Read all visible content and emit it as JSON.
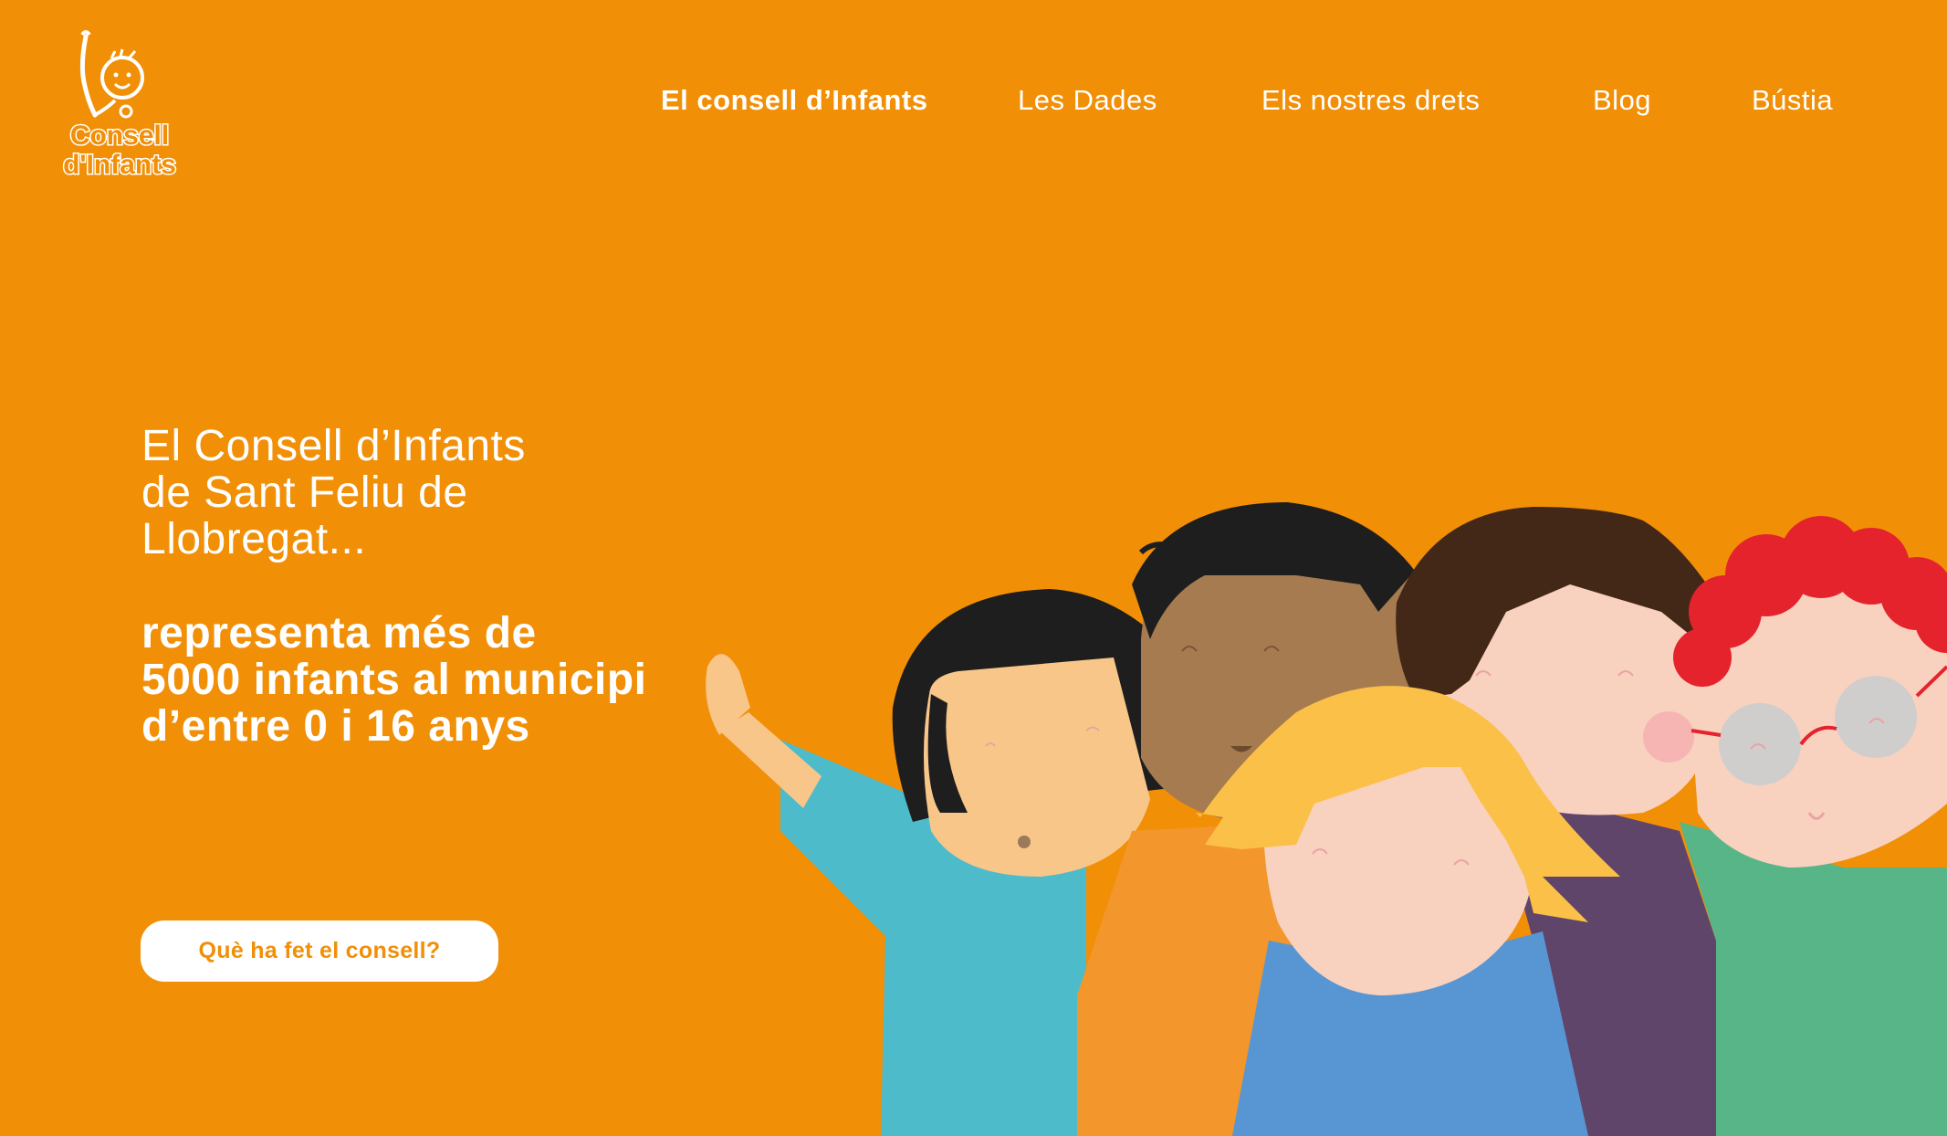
{
  "logo": {
    "line1": "Consell",
    "line2": "d'Infants"
  },
  "nav": {
    "items": [
      {
        "label": "El consell d’Infants",
        "active": true
      },
      {
        "label": "Les Dades",
        "active": false
      },
      {
        "label": "Els nostres drets",
        "active": false
      },
      {
        "label": "Blog",
        "active": false
      },
      {
        "label": "Bústia",
        "active": false
      }
    ]
  },
  "hero": {
    "title_lines": [
      "El Consell d’Infants",
      "de Sant Feliu de",
      "Llobregat..."
    ],
    "subtitle_lines": [
      "representa més de",
      "5000 infants al municipi",
      "d’entre 0 i 16 anys"
    ],
    "cta_label": "Què ha fet el consell?"
  },
  "colors": {
    "background": "#F18F07",
    "text": "#FFFFFF",
    "button_bg": "#FFFFFF",
    "button_text": "#F18F07"
  }
}
